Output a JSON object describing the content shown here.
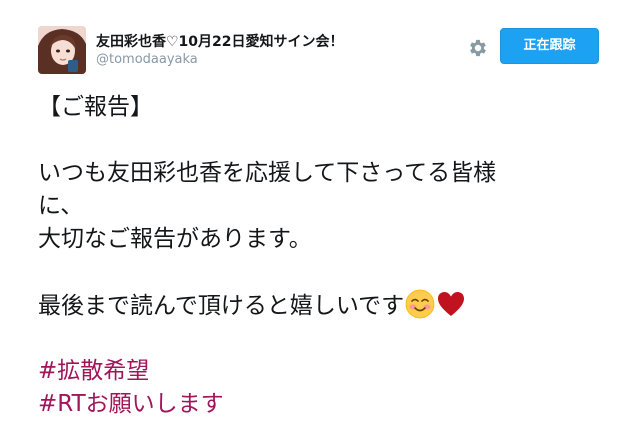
{
  "user": {
    "display_name": "友田彩也香♡10月22日愛知サイン会！",
    "screen_name": "@tomodaayaka"
  },
  "actions": {
    "settings_icon": "gear-icon",
    "follow_label": "正在跟踪"
  },
  "tweet": {
    "lines": [
      "【ご報告】",
      "",
      "いつも友田彩也香を応援して下さってる皆様",
      "に、",
      "大切なご報告があります。",
      "",
      "最後まで読んで頂けると嬉しいです"
    ],
    "emojis": [
      "smiling-face-icon",
      "heart-icon"
    ],
    "hashtags": [
      "#拡散希望",
      "#RTお願いします"
    ]
  },
  "colors": {
    "follow_bg": "#1da1f2",
    "hashtag": "#a1155a",
    "screen_name": "#8899a6"
  }
}
